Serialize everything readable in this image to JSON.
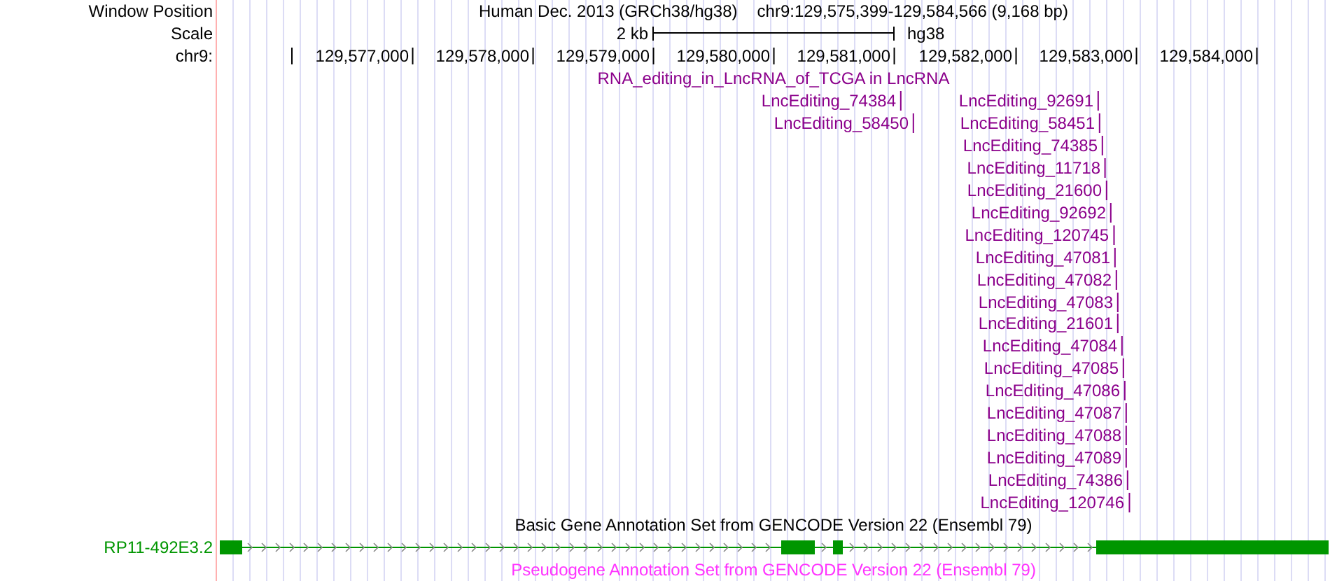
{
  "header": {
    "label": "Window Position",
    "assembly": "Human Dec. 2013 (GRCh38/hg38)",
    "position": "chr9:129,575,399-129,584,566 (9,168 bp)"
  },
  "scale": {
    "label": "Scale",
    "size": "2 kb",
    "assembly": "hg38"
  },
  "ruler": {
    "label": "chr9:",
    "ticks": [
      "129,577,000",
      "129,578,000",
      "129,579,000",
      "129,580,000",
      "129,581,000",
      "129,582,000",
      "129,583,000",
      "129,584,000"
    ]
  },
  "tracks": [
    {
      "kind": "features",
      "title": "RNA_editing_in_LncRNA_of_TCGA in LncRNA",
      "color": "#8b008b",
      "rows": [
        [
          {
            "name": "LncEditing_74384"
          },
          {
            "name": "LncEditing_92691"
          }
        ],
        [
          {
            "name": "LncEditing_58450"
          },
          {
            "name": "LncEditing_58451"
          }
        ],
        [
          {
            "name": "LncEditing_74385"
          }
        ],
        [
          {
            "name": "LncEditing_11718"
          }
        ],
        [
          {
            "name": "LncEditing_21600"
          }
        ],
        [
          {
            "name": "LncEditing_92692"
          }
        ],
        [
          {
            "name": "LncEditing_120745"
          }
        ],
        [
          {
            "name": "LncEditing_47081"
          }
        ],
        [
          {
            "name": "LncEditing_47082"
          }
        ],
        [
          {
            "name": "LncEditing_47083"
          }
        ],
        [
          {
            "name": "LncEditing_21601"
          }
        ],
        [
          {
            "name": "LncEditing_47084"
          }
        ],
        [
          {
            "name": "LncEditing_47085"
          }
        ],
        [
          {
            "name": "LncEditing_47086"
          }
        ],
        [
          {
            "name": "LncEditing_47087"
          }
        ],
        [
          {
            "name": "LncEditing_47088"
          }
        ],
        [
          {
            "name": "LncEditing_47089"
          }
        ],
        [
          {
            "name": "LncEditing_74386"
          }
        ],
        [
          {
            "name": "LncEditing_120746"
          }
        ]
      ]
    },
    {
      "kind": "gene",
      "title": "Basic Gene Annotation Set from GENCODE Version 22 (Ensembl 79)",
      "color": "#000000",
      "gene": {
        "name": "RP11-492E3.2",
        "color": "#009600"
      }
    },
    {
      "kind": "title",
      "title": "Pseudogene Annotation Set from GENCODE Version 22 (Ensembl 79)",
      "color": "#ff33ff"
    }
  ]
}
